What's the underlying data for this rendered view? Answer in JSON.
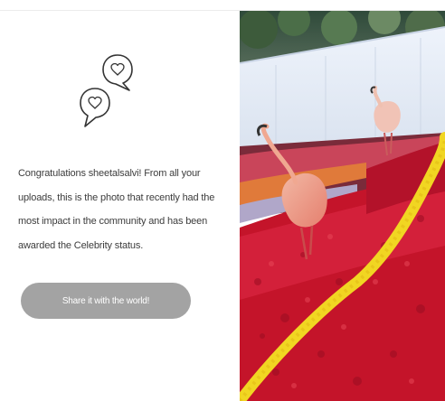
{
  "celebrity": {
    "message": "Congratulations sheetalsalvi! From all your uploads, this is the photo that recently had the most impact in the community and has been awarded the Celebrity status.",
    "share_label": "Share it with the world!",
    "icon": "heart-speech-bubbles-icon",
    "photo_icon": "flamingo-flower-garden-photo"
  },
  "colors": {
    "button_bg": "#a3a3a3",
    "button_text": "#ffffff",
    "body_text": "#3c3c3c",
    "icon_stroke": "#333333"
  }
}
